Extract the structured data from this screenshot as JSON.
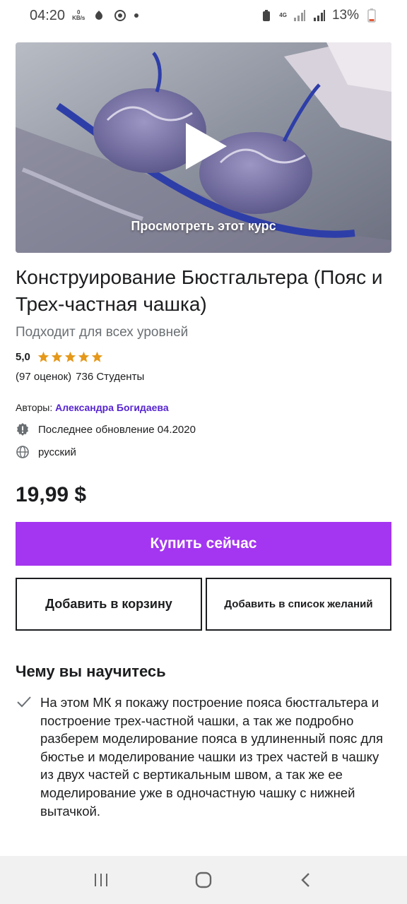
{
  "status_bar": {
    "time": "04:20",
    "speed_value": "0",
    "speed_unit": "KB/s",
    "network_type": "4G",
    "battery": "13%"
  },
  "hero": {
    "preview_label": "Просмотреть этот курс"
  },
  "course": {
    "title": "Конструирование Бюстгальтера (Пояс и Трех-частная чашка)",
    "level": "Подходит для всех уровней",
    "rating": "5,0",
    "stars": 5,
    "ratings_count": "(97 оценок)",
    "students": "736 Студенты",
    "authors_label": "Авторы:",
    "author_name": "Александра Богидаева",
    "last_update": "Последнее обновление 04.2020",
    "language": "русский",
    "price": "19,99 $"
  },
  "actions": {
    "buy_now": "Купить сейчас",
    "add_to_cart": "Добавить в корзину",
    "add_to_wishlist": "Добавить в список желаний"
  },
  "learn": {
    "heading": "Чему вы научитесь",
    "items": [
      "На этом МК я покажу построение пояса бюстгальтера и построение трех-частной чашки, а так же подробно разберем моделирование пояса в удлиненный пояс для бюстье и моделирование чашки из трех частей в чашку из двух частей с вертикальным швом, а так же ее моделирование уже в одночастную чашку с нижней вытачкой."
    ]
  },
  "colors": {
    "accent": "#a435f0",
    "author_link": "#5624d0",
    "star": "#e59819"
  },
  "icons": {
    "play": "play-icon",
    "alert": "alert-badge-icon",
    "globe": "globe-icon",
    "check": "check-icon",
    "nav_recent": "recent-apps-icon",
    "nav_home": "home-icon",
    "nav_back": "back-icon"
  }
}
